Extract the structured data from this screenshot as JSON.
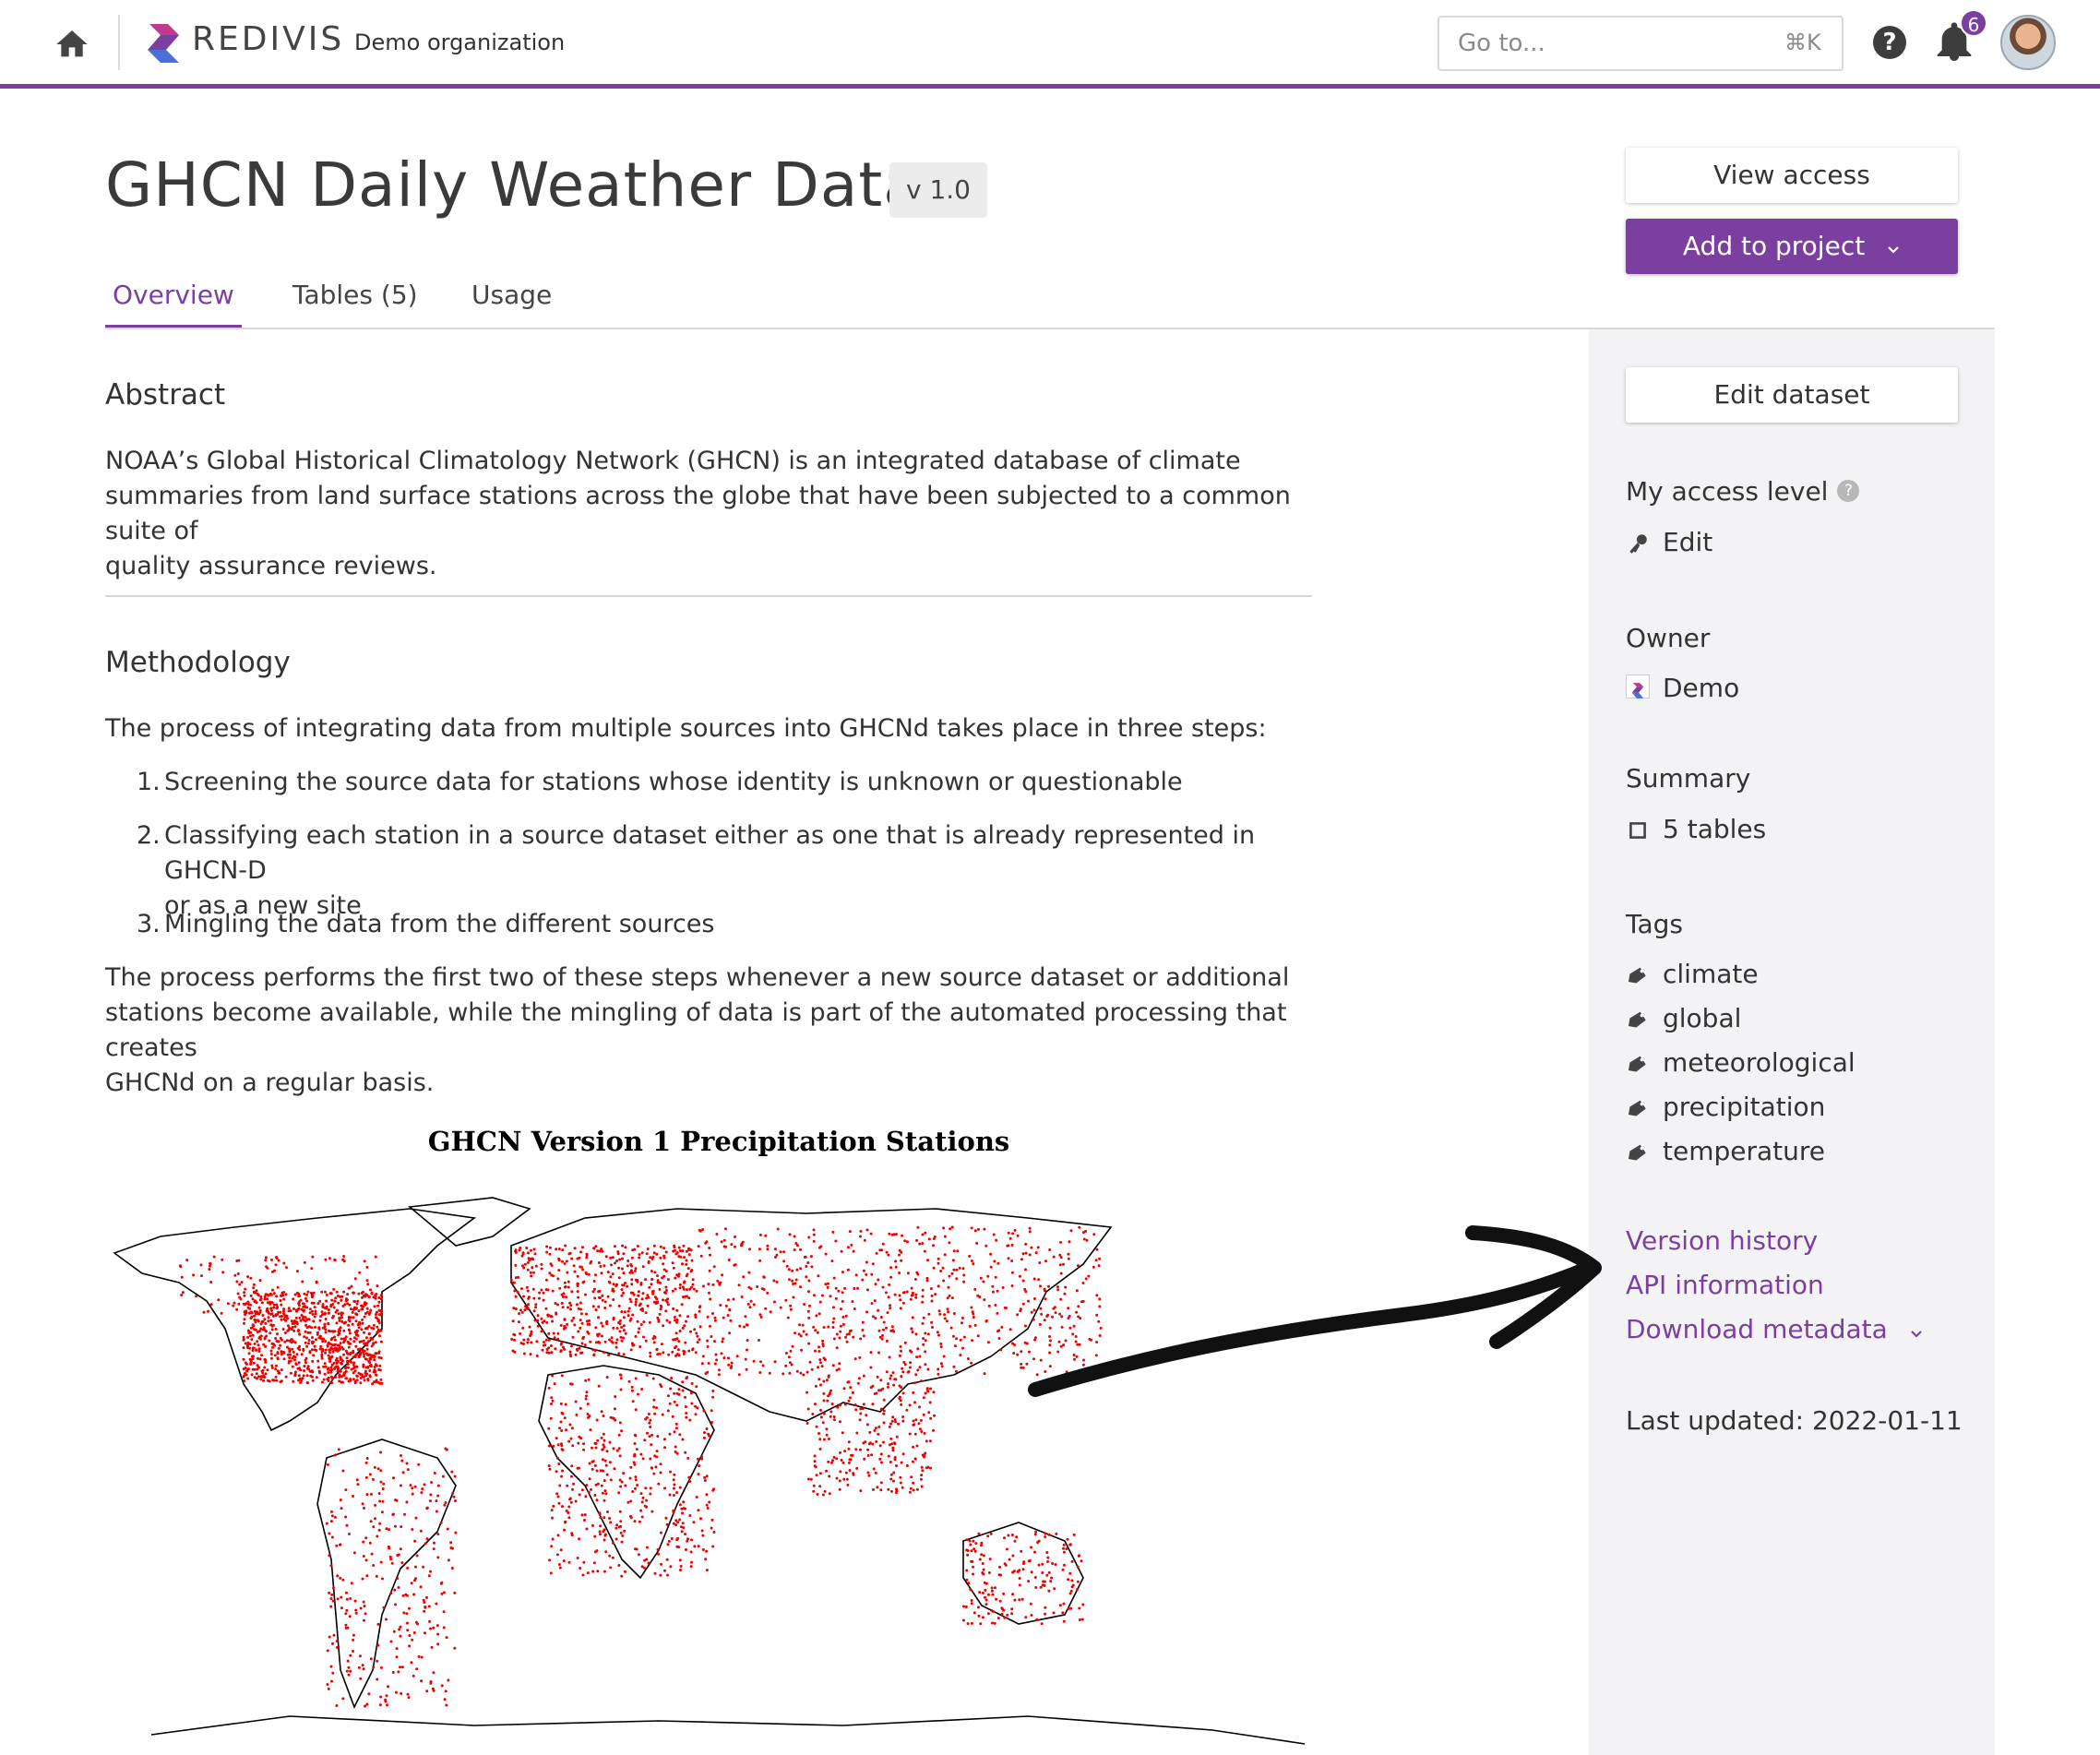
{
  "topbar": {
    "brand": "REDIVIS",
    "org": "Demo organization",
    "search_placeholder": "Go to...",
    "search_shortcut": "⌘K",
    "help_label": "?",
    "notification_count": "6"
  },
  "dataset": {
    "title": "GHCN Daily Weather Data",
    "version": "v 1.0"
  },
  "actions": {
    "view_access": "View access",
    "add_to_project": "Add to project",
    "edit_dataset": "Edit dataset"
  },
  "tabs": [
    {
      "label": "Overview",
      "active": true
    },
    {
      "label": "Tables (5)",
      "active": false
    },
    {
      "label": "Usage",
      "active": false
    }
  ],
  "abstract": {
    "heading": "Abstract",
    "lines": [
      "NOAA’s Global Historical Climatology Network (GHCN) is an integrated database of climate",
      "summaries from land surface stations across the globe that have been subjected to a common suite of",
      "quality assurance reviews."
    ]
  },
  "methodology": {
    "heading": "Methodology",
    "intro": "The process of integrating data from multiple sources into GHCNd takes place in three steps:",
    "steps": [
      {
        "num": "1.",
        "lines": [
          "Screening the source data for stations whose identity is unknown or questionable"
        ]
      },
      {
        "num": "2.",
        "lines": [
          "Classifying each station in a source dataset either as one that is already represented in GHCN-D",
          "or as a new site"
        ]
      },
      {
        "num": "3.",
        "lines": [
          "Mingling the data from the different sources"
        ]
      }
    ],
    "outro": [
      "The process performs the first two of these steps whenever a new source dataset or additional",
      "stations become available, while the mingling of data is part of the automated processing that creates",
      "GHCNd on a regular basis."
    ]
  },
  "figure": {
    "title": "GHCN Version 1 Precipitation Stations"
  },
  "sidebar": {
    "access_heading": "My access level",
    "access_help": "?",
    "access_value": "Edit",
    "owner_heading": "Owner",
    "owner_value": "Demo",
    "summary_heading": "Summary",
    "summary_value": "5 tables",
    "tags_heading": "Tags",
    "tags": [
      "climate",
      "global",
      "meteorological",
      "precipitation",
      "temperature"
    ],
    "links": {
      "version_history": "Version history",
      "api_information": "API information",
      "download_metadata": "Download metadata"
    },
    "last_updated": "Last updated: 2022-01-11"
  },
  "colors": {
    "accent": "#7b3fa0",
    "sidebar_bg": "#f3f3f5",
    "station_dot": "#ee0000"
  },
  "icons": {
    "home": "home-icon",
    "logo": "redivis-logo-icon",
    "help": "help-circle-icon",
    "bell": "bell-icon",
    "key": "key-icon",
    "table": "square-icon",
    "tag": "tag-icon",
    "chevron": "chevron-down-icon"
  }
}
